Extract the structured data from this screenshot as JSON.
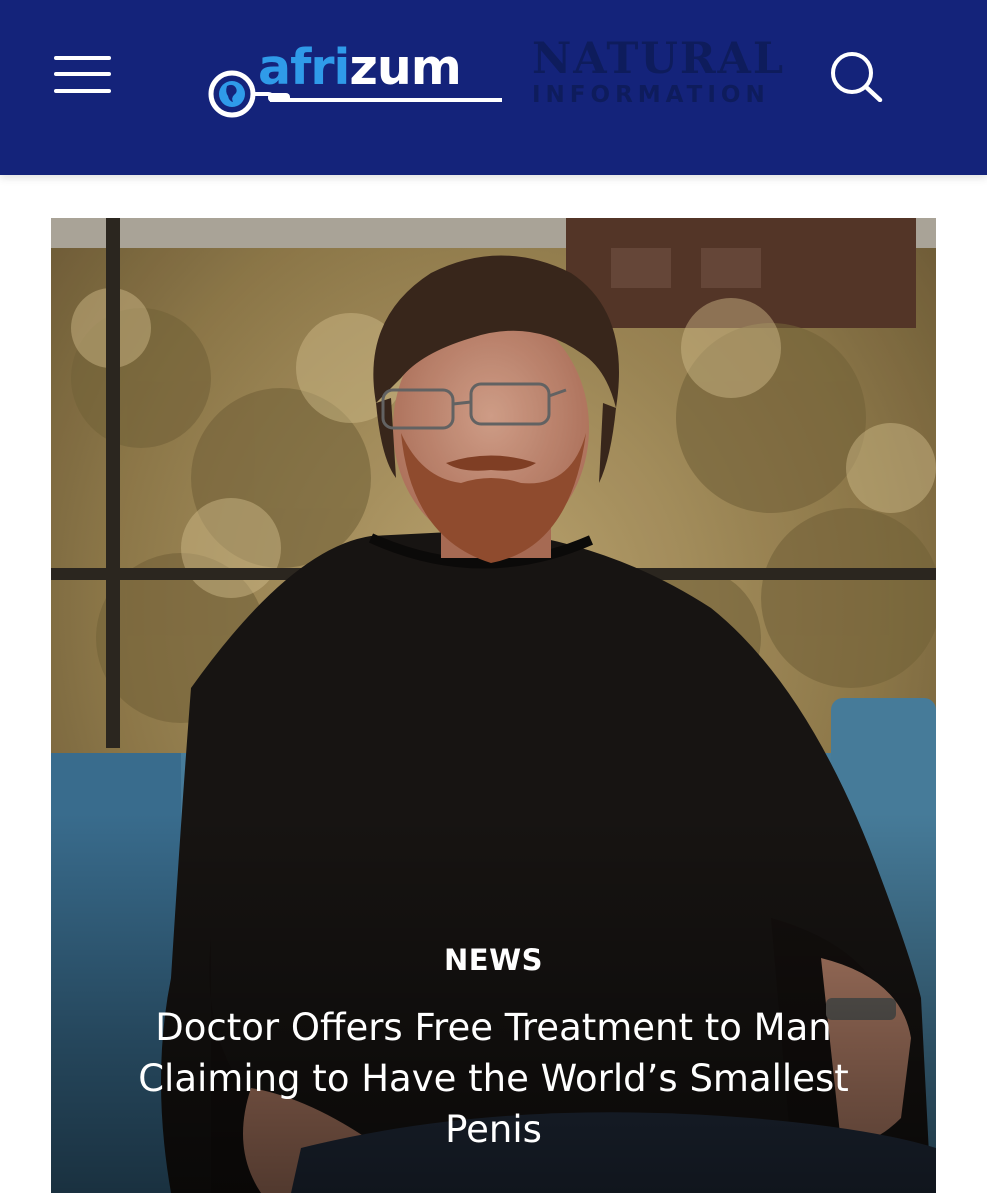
{
  "header": {
    "background_color": "#14237a",
    "logo": {
      "part1": "afri",
      "part2": "zum",
      "accent_color": "#2f9be9"
    },
    "tagline": {
      "line1": "NATURAL",
      "line2": "INFORMATION"
    },
    "menu_icon": "hamburger-menu-icon",
    "search_icon": "search-icon"
  },
  "article": {
    "category": "NEWS",
    "title": "Doctor Offers Free Treatment to Man Claiming to Have the World’s Smallest Penis"
  }
}
